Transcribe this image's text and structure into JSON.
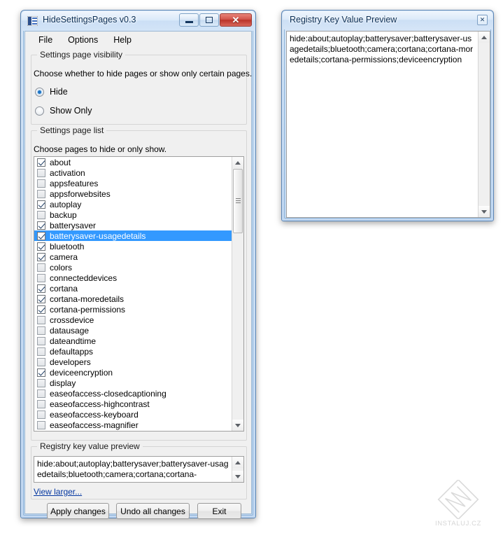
{
  "main_window": {
    "title": "HideSettingsPages v0.3",
    "icon": "app-icon",
    "caption_buttons": {
      "minimize": "minimize-icon",
      "maximize": "maximize-icon",
      "close": "✕"
    },
    "menu": [
      {
        "label": "File"
      },
      {
        "label": "Options"
      },
      {
        "label": "Help"
      }
    ],
    "visibility_group": {
      "legend": "Settings page visibility",
      "help": "Choose whether to hide pages or show only certain pages.",
      "options": [
        {
          "label": "Hide",
          "selected": true
        },
        {
          "label": "Show Only",
          "selected": false
        }
      ]
    },
    "list_group": {
      "legend": "Settings page list",
      "help": "Choose pages to hide or only show.",
      "items": [
        {
          "label": "about",
          "checked": true,
          "selected": false
        },
        {
          "label": "activation",
          "checked": false,
          "selected": false
        },
        {
          "label": "appsfeatures",
          "checked": false,
          "selected": false
        },
        {
          "label": "appsforwebsites",
          "checked": false,
          "selected": false
        },
        {
          "label": "autoplay",
          "checked": true,
          "selected": false
        },
        {
          "label": "backup",
          "checked": false,
          "selected": false
        },
        {
          "label": "batterysaver",
          "checked": true,
          "selected": false
        },
        {
          "label": "batterysaver-usagedetails",
          "checked": true,
          "selected": true
        },
        {
          "label": "bluetooth",
          "checked": true,
          "selected": false
        },
        {
          "label": "camera",
          "checked": true,
          "selected": false
        },
        {
          "label": "colors",
          "checked": false,
          "selected": false
        },
        {
          "label": "connecteddevices",
          "checked": false,
          "selected": false
        },
        {
          "label": "cortana",
          "checked": true,
          "selected": false
        },
        {
          "label": "cortana-moredetails",
          "checked": true,
          "selected": false
        },
        {
          "label": "cortana-permissions",
          "checked": true,
          "selected": false
        },
        {
          "label": "crossdevice",
          "checked": false,
          "selected": false
        },
        {
          "label": "datausage",
          "checked": false,
          "selected": false
        },
        {
          "label": "dateandtime",
          "checked": false,
          "selected": false
        },
        {
          "label": "defaultapps",
          "checked": false,
          "selected": false
        },
        {
          "label": "developers",
          "checked": false,
          "selected": false
        },
        {
          "label": "deviceencryption",
          "checked": true,
          "selected": false
        },
        {
          "label": "display",
          "checked": false,
          "selected": false
        },
        {
          "label": "easeofaccess-closedcaptioning",
          "checked": false,
          "selected": false
        },
        {
          "label": "easeofaccess-highcontrast",
          "checked": false,
          "selected": false
        },
        {
          "label": "easeofaccess-keyboard",
          "checked": false,
          "selected": false
        },
        {
          "label": "easeofaccess-magnifier",
          "checked": false,
          "selected": false
        }
      ]
    },
    "preview_group": {
      "legend": "Registry key value preview",
      "value": "hide:about;autoplay;batterysaver;batterysaver-usagedetails;bluetooth;camera;cortana;cortana-",
      "view_larger_link": "View larger..."
    },
    "buttons": [
      {
        "label": "Apply changes"
      },
      {
        "label": "Undo all changes"
      },
      {
        "label": "Exit"
      }
    ]
  },
  "preview_window": {
    "title": "Registry Key Value Preview",
    "close_glyph": "✕",
    "value": "hide:about;autoplay;batterysaver;batterysaver-usagedetails;bluetooth;camera;cortana;cortana-moredetails;cortana-permissions;deviceencryption"
  },
  "watermark": {
    "text": "INSTALUJ.CZ"
  },
  "colors": {
    "selection": "#3399ff",
    "link": "#0437a0",
    "close_button": "#ba3429",
    "title_text": "#0c2f55"
  }
}
